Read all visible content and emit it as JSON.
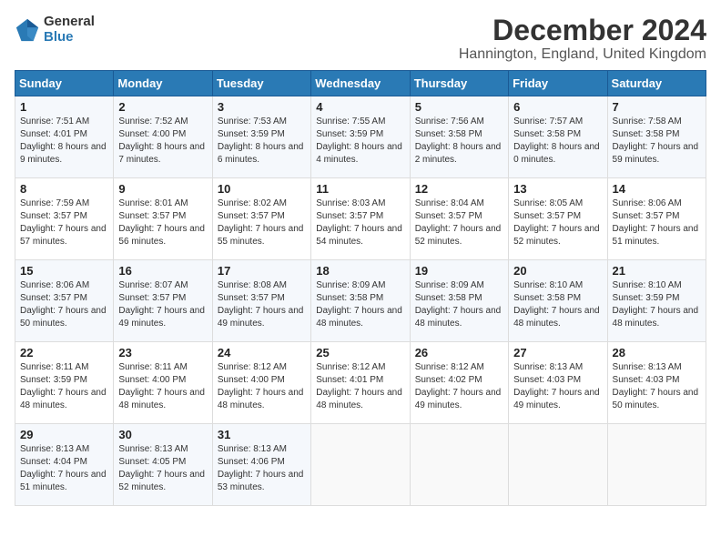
{
  "logo": {
    "line1": "General",
    "line2": "Blue"
  },
  "title": "December 2024",
  "subtitle": "Hannington, England, United Kingdom",
  "days_of_week": [
    "Sunday",
    "Monday",
    "Tuesday",
    "Wednesday",
    "Thursday",
    "Friday",
    "Saturday"
  ],
  "weeks": [
    [
      {
        "day": "1",
        "sunrise": "Sunrise: 7:51 AM",
        "sunset": "Sunset: 4:01 PM",
        "daylight": "Daylight: 8 hours and 9 minutes."
      },
      {
        "day": "2",
        "sunrise": "Sunrise: 7:52 AM",
        "sunset": "Sunset: 4:00 PM",
        "daylight": "Daylight: 8 hours and 7 minutes."
      },
      {
        "day": "3",
        "sunrise": "Sunrise: 7:53 AM",
        "sunset": "Sunset: 3:59 PM",
        "daylight": "Daylight: 8 hours and 6 minutes."
      },
      {
        "day": "4",
        "sunrise": "Sunrise: 7:55 AM",
        "sunset": "Sunset: 3:59 PM",
        "daylight": "Daylight: 8 hours and 4 minutes."
      },
      {
        "day": "5",
        "sunrise": "Sunrise: 7:56 AM",
        "sunset": "Sunset: 3:58 PM",
        "daylight": "Daylight: 8 hours and 2 minutes."
      },
      {
        "day": "6",
        "sunrise": "Sunrise: 7:57 AM",
        "sunset": "Sunset: 3:58 PM",
        "daylight": "Daylight: 8 hours and 0 minutes."
      },
      {
        "day": "7",
        "sunrise": "Sunrise: 7:58 AM",
        "sunset": "Sunset: 3:58 PM",
        "daylight": "Daylight: 7 hours and 59 minutes."
      }
    ],
    [
      {
        "day": "8",
        "sunrise": "Sunrise: 7:59 AM",
        "sunset": "Sunset: 3:57 PM",
        "daylight": "Daylight: 7 hours and 57 minutes."
      },
      {
        "day": "9",
        "sunrise": "Sunrise: 8:01 AM",
        "sunset": "Sunset: 3:57 PM",
        "daylight": "Daylight: 7 hours and 56 minutes."
      },
      {
        "day": "10",
        "sunrise": "Sunrise: 8:02 AM",
        "sunset": "Sunset: 3:57 PM",
        "daylight": "Daylight: 7 hours and 55 minutes."
      },
      {
        "day": "11",
        "sunrise": "Sunrise: 8:03 AM",
        "sunset": "Sunset: 3:57 PM",
        "daylight": "Daylight: 7 hours and 54 minutes."
      },
      {
        "day": "12",
        "sunrise": "Sunrise: 8:04 AM",
        "sunset": "Sunset: 3:57 PM",
        "daylight": "Daylight: 7 hours and 52 minutes."
      },
      {
        "day": "13",
        "sunrise": "Sunrise: 8:05 AM",
        "sunset": "Sunset: 3:57 PM",
        "daylight": "Daylight: 7 hours and 52 minutes."
      },
      {
        "day": "14",
        "sunrise": "Sunrise: 8:06 AM",
        "sunset": "Sunset: 3:57 PM",
        "daylight": "Daylight: 7 hours and 51 minutes."
      }
    ],
    [
      {
        "day": "15",
        "sunrise": "Sunrise: 8:06 AM",
        "sunset": "Sunset: 3:57 PM",
        "daylight": "Daylight: 7 hours and 50 minutes."
      },
      {
        "day": "16",
        "sunrise": "Sunrise: 8:07 AM",
        "sunset": "Sunset: 3:57 PM",
        "daylight": "Daylight: 7 hours and 49 minutes."
      },
      {
        "day": "17",
        "sunrise": "Sunrise: 8:08 AM",
        "sunset": "Sunset: 3:57 PM",
        "daylight": "Daylight: 7 hours and 49 minutes."
      },
      {
        "day": "18",
        "sunrise": "Sunrise: 8:09 AM",
        "sunset": "Sunset: 3:58 PM",
        "daylight": "Daylight: 7 hours and 48 minutes."
      },
      {
        "day": "19",
        "sunrise": "Sunrise: 8:09 AM",
        "sunset": "Sunset: 3:58 PM",
        "daylight": "Daylight: 7 hours and 48 minutes."
      },
      {
        "day": "20",
        "sunrise": "Sunrise: 8:10 AM",
        "sunset": "Sunset: 3:58 PM",
        "daylight": "Daylight: 7 hours and 48 minutes."
      },
      {
        "day": "21",
        "sunrise": "Sunrise: 8:10 AM",
        "sunset": "Sunset: 3:59 PM",
        "daylight": "Daylight: 7 hours and 48 minutes."
      }
    ],
    [
      {
        "day": "22",
        "sunrise": "Sunrise: 8:11 AM",
        "sunset": "Sunset: 3:59 PM",
        "daylight": "Daylight: 7 hours and 48 minutes."
      },
      {
        "day": "23",
        "sunrise": "Sunrise: 8:11 AM",
        "sunset": "Sunset: 4:00 PM",
        "daylight": "Daylight: 7 hours and 48 minutes."
      },
      {
        "day": "24",
        "sunrise": "Sunrise: 8:12 AM",
        "sunset": "Sunset: 4:00 PM",
        "daylight": "Daylight: 7 hours and 48 minutes."
      },
      {
        "day": "25",
        "sunrise": "Sunrise: 8:12 AM",
        "sunset": "Sunset: 4:01 PM",
        "daylight": "Daylight: 7 hours and 48 minutes."
      },
      {
        "day": "26",
        "sunrise": "Sunrise: 8:12 AM",
        "sunset": "Sunset: 4:02 PM",
        "daylight": "Daylight: 7 hours and 49 minutes."
      },
      {
        "day": "27",
        "sunrise": "Sunrise: 8:13 AM",
        "sunset": "Sunset: 4:03 PM",
        "daylight": "Daylight: 7 hours and 49 minutes."
      },
      {
        "day": "28",
        "sunrise": "Sunrise: 8:13 AM",
        "sunset": "Sunset: 4:03 PM",
        "daylight": "Daylight: 7 hours and 50 minutes."
      }
    ],
    [
      {
        "day": "29",
        "sunrise": "Sunrise: 8:13 AM",
        "sunset": "Sunset: 4:04 PM",
        "daylight": "Daylight: 7 hours and 51 minutes."
      },
      {
        "day": "30",
        "sunrise": "Sunrise: 8:13 AM",
        "sunset": "Sunset: 4:05 PM",
        "daylight": "Daylight: 7 hours and 52 minutes."
      },
      {
        "day": "31",
        "sunrise": "Sunrise: 8:13 AM",
        "sunset": "Sunset: 4:06 PM",
        "daylight": "Daylight: 7 hours and 53 minutes."
      },
      null,
      null,
      null,
      null
    ]
  ]
}
